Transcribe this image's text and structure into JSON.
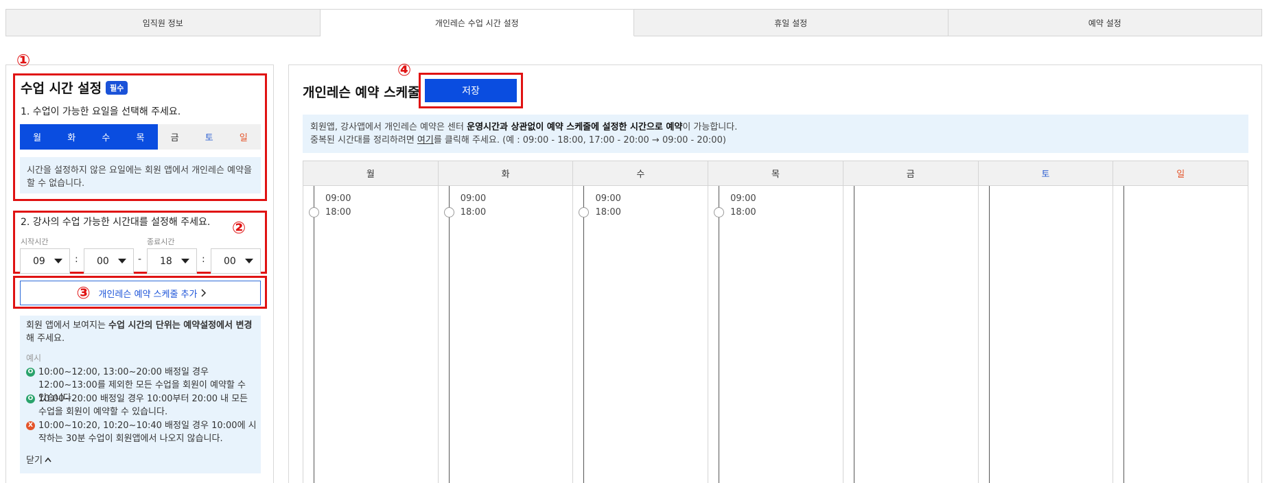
{
  "tabs": [
    {
      "label": "임직원 정보",
      "active": false
    },
    {
      "label": "개인레슨 수업 시간 설정",
      "active": true
    },
    {
      "label": "휴일 설정",
      "active": false
    },
    {
      "label": "예약 설정",
      "active": false
    }
  ],
  "markers": {
    "m1": "①",
    "m2": "②",
    "m3": "③",
    "m4": "④"
  },
  "class_time": {
    "title": "수업 시간 설정",
    "required_badge": "필수",
    "step1": "1. 수업이 가능한 요일을 선택해 주세요.",
    "days": [
      {
        "label": "월",
        "selected": true
      },
      {
        "label": "화",
        "selected": true
      },
      {
        "label": "수",
        "selected": true
      },
      {
        "label": "목",
        "selected": true
      },
      {
        "label": "금",
        "selected": false
      },
      {
        "label": "토",
        "selected": false
      },
      {
        "label": "일",
        "selected": false
      }
    ],
    "day_note": "시간을 설정하지 않은 요일에는 회원 앱에서 개인레슨 예약을 할 수 없습니다.",
    "step2": "2. 강사의 수업 가능한 시간대를 설정해 주세요.",
    "start_label": "시작시간",
    "end_label": "종료시간",
    "start_hour": "09",
    "start_minute": "00",
    "end_hour": "18",
    "end_minute": "00",
    "colon": ":",
    "dash": "-",
    "add_button": "개인레슨 예약 스케줄 추가",
    "info_text_pre": "회원 앱에서 보여지는 ",
    "info_text_bold": "수업 시간의 단위는 예약설정에서 변경",
    "info_text_post": "해 주세요.",
    "example_label": "예시",
    "examples": [
      {
        "kind": "ok",
        "mark": "O",
        "text": "10:00~12:00, 13:00~20:00 배정일 경우 12:00~13:00를 제외한 모든 수업을 회원이 예약할 수 있습니다."
      },
      {
        "kind": "ok",
        "mark": "O",
        "text": "10:00~20:00 배정일 경우 10:00부터 20:00 내 모든 수업을 회원이 예약할 수 있습니다."
      },
      {
        "kind": "no",
        "mark": "X",
        "text": "10:00~10:20, 10:20~10:40 배정일 경우 10:00에 시작하는 30분 수업이 회원앱에서 나오지 않습니다."
      }
    ],
    "close_label": "닫기"
  },
  "schedule": {
    "title": "개인레슨 예약 스케줄",
    "save_button": "저장",
    "notice_1_pre": "회원앱, 강사앱에서 개인레슨 예약은 센터 ",
    "notice_1_bold": "운영시간과 상관없이 예약 스케줄에 설정한 시간으로 예약",
    "notice_1_post": "이 가능합니다.",
    "notice_2_pre": "중복된 시간대를 정리하려면 ",
    "notice_2_link": "여기",
    "notice_2_post": "를 클릭해 주세요. (예 : 09:00 - 18:00, 17:00 - 20:00 → 09:00 - 20:00)",
    "columns": [
      {
        "day": "월",
        "start": "09:00",
        "end": "18:00"
      },
      {
        "day": "화",
        "start": "09:00",
        "end": "18:00"
      },
      {
        "day": "수",
        "start": "09:00",
        "end": "18:00"
      },
      {
        "day": "목",
        "start": "09:00",
        "end": "18:00"
      },
      {
        "day": "금",
        "start": "",
        "end": ""
      },
      {
        "day": "토",
        "start": "",
        "end": ""
      },
      {
        "day": "일",
        "start": "",
        "end": ""
      }
    ]
  },
  "colors": {
    "accent": "#0a4de0",
    "annotation": "#e01212",
    "info_bg": "#e8f3fc",
    "saturday": "#2c5fd1",
    "sunday": "#e4542a"
  }
}
